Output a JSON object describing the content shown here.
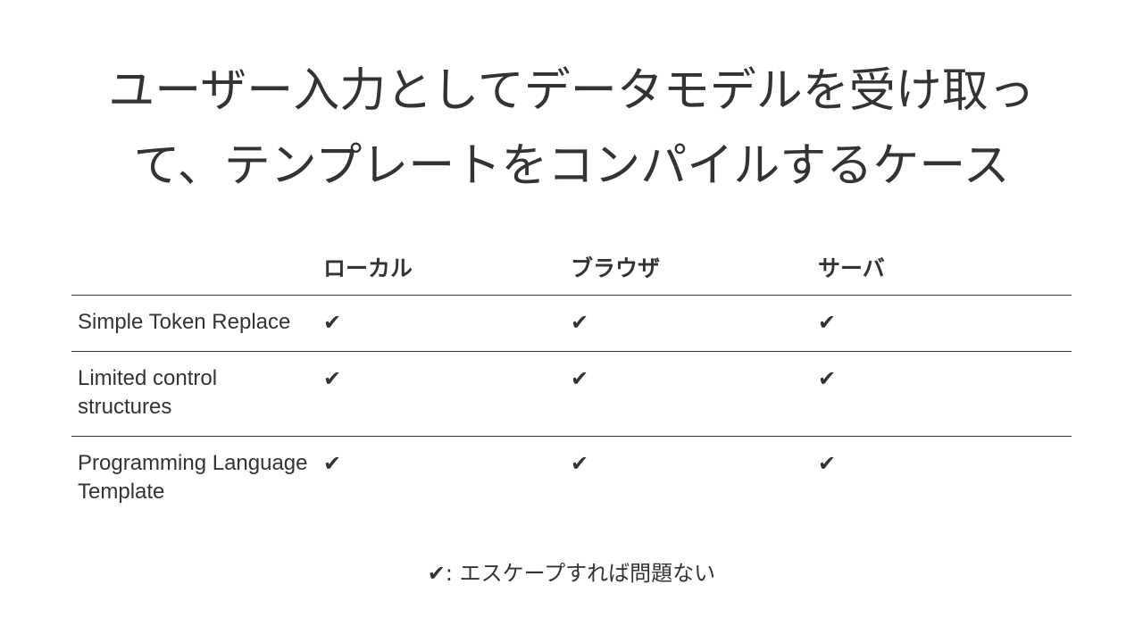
{
  "slide": {
    "title_line1": "ユーザー入力としてデータモデルを受け取っ",
    "title_line2": "て、テンプレートをコンパイルするケース"
  },
  "table": {
    "columns": [
      "ローカル",
      "ブラウザ",
      "サーバ"
    ],
    "rows": [
      {
        "label": "Simple Token Replace",
        "local": "✔",
        "browser": "✔",
        "server": "✔"
      },
      {
        "label": "Limited control structures",
        "local": "✔",
        "browser": "✔",
        "server": "✔"
      },
      {
        "label": "Programming Language Template",
        "local": "✔",
        "browser": "✔",
        "server": "✔"
      }
    ]
  },
  "footnote": {
    "mark": "✔",
    "text": ": エスケープすれば問題ない"
  }
}
